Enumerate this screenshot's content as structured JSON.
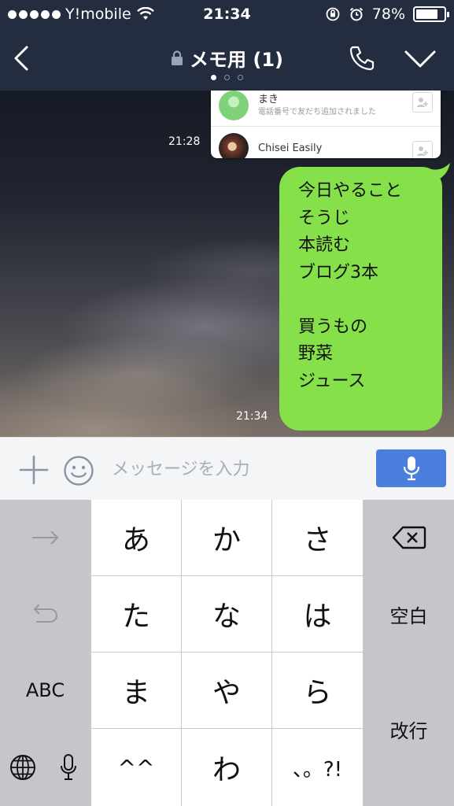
{
  "status_bar": {
    "carrier": "Y!mobile",
    "time": "21:34",
    "battery_percent": "78%",
    "battery_level": 0.78,
    "icons": [
      "signal-dots-icon",
      "wifi-icon",
      "orientation-lock-icon",
      "alarm-icon",
      "battery-icon"
    ]
  },
  "header": {
    "title": "メモ用 (1)",
    "icons": [
      "back-chevron-icon",
      "lock-icon",
      "phone-icon",
      "chevron-down-icon"
    ],
    "page_indicator": {
      "pages": 3,
      "active": 1
    }
  },
  "shared_card": {
    "contacts": [
      {
        "name": "まき",
        "subtitle": "電話番号で友だち追加されました",
        "action_icon": "add-friend-icon"
      },
      {
        "name": "Chisei Easily",
        "subtitle": "",
        "action_icon": "add-friend-icon"
      }
    ],
    "timestamp": "21:28"
  },
  "message": {
    "text": "今日やること\nそうじ\n本読む\nブログ3本\n\n買うもの\n野菜\nジュース",
    "timestamp": "21:34",
    "bubble_color": "#85e04a"
  },
  "input_bar": {
    "placeholder": "メッセージを入力",
    "icons": [
      "plus-icon",
      "emoji-icon",
      "microphone-icon"
    ],
    "mic_button_color": "#4a7fde"
  },
  "keyboard": {
    "rows": [
      [
        "→",
        "あ",
        "か",
        "さ",
        "⌫"
      ],
      [
        "↺",
        "た",
        "な",
        "は",
        "空白"
      ],
      [
        "ABC",
        "ま",
        "や",
        "ら",
        "改行"
      ],
      [
        "🌐",
        "🎤",
        "^^",
        "わ",
        "、。?!"
      ]
    ],
    "keys": {
      "next": "→",
      "a": "あ",
      "ka": "か",
      "sa": "さ",
      "undo": "↺",
      "ta": "た",
      "na": "な",
      "ha": "は",
      "space": "空白",
      "abc": "ABC",
      "ma": "ま",
      "ya": "や",
      "ra": "ら",
      "return": "改行",
      "emoticon": "^^",
      "wa": "わ",
      "punct": "、。?!"
    }
  },
  "colors": {
    "header_bg": "#242c3f",
    "keyboard_bg": "#c9cacd",
    "key_white": "#ffffff",
    "key_gray": "#c4c6cb"
  }
}
